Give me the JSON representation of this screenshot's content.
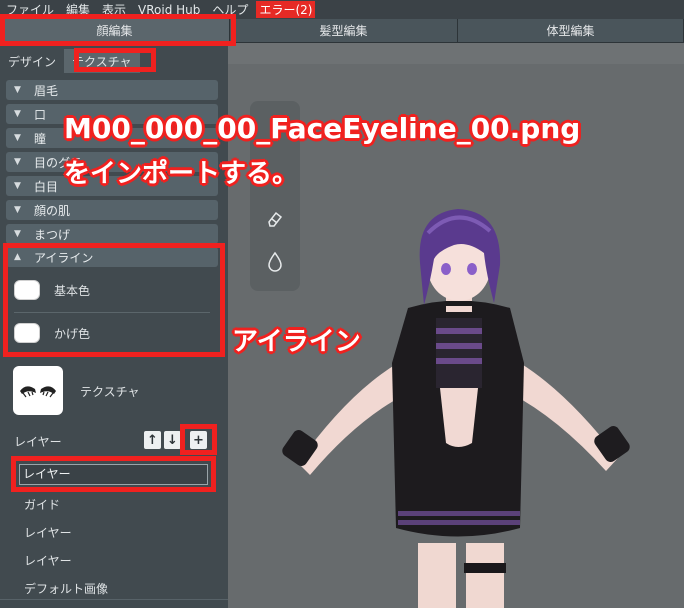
{
  "menubar": {
    "items": [
      "ファイル",
      "編集",
      "表示",
      "VRoid Hub",
      "ヘルプ"
    ],
    "error": "エラー(2)"
  },
  "top_tabs": [
    "顔編集",
    "髪型編集",
    "体型編集"
  ],
  "sub_tabs": [
    "デザイン",
    "テクスチャ"
  ],
  "sections": [
    "眉毛",
    "口",
    "瞳",
    "目のグラ",
    "白目",
    "顔の肌",
    "まつげ"
  ],
  "eyeline": {
    "header": "アイライン",
    "base_color": "基本色",
    "shade_color": "かげ色"
  },
  "texture_label": "テクスチャ",
  "layers": {
    "label": "レイヤー",
    "selected": "レイヤー",
    "items": [
      "ガイド",
      "レイヤー",
      "レイヤー",
      "デフォルト画像"
    ]
  },
  "annotations": {
    "filename": "M00_000_00_FaceEyeline_00.png",
    "instruction": "をインポートする。",
    "eyeline": "アイライン"
  },
  "colors": {
    "highlight": "#f0211f",
    "panel": "#414a4f",
    "viewport": "#676b6d"
  },
  "icons": [
    "arrow-up-icon",
    "arrow-down-icon",
    "plus-icon",
    "eraser-icon",
    "dropper-icon",
    "chevron-down-icon",
    "chevron-up-icon"
  ]
}
